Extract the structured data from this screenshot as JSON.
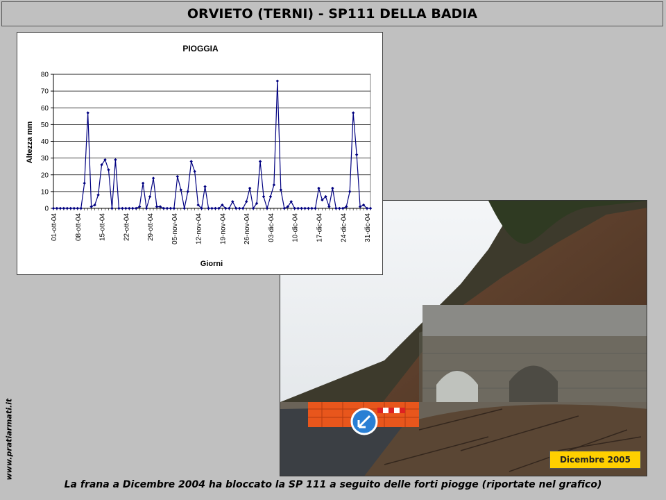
{
  "header": {
    "title": "ORVIETO (TERNI) - SP111 DELLA BADIA"
  },
  "side_url": "www.pratiarmati.it",
  "photo": {
    "date_label": "Dicembre 2005",
    "accent_color": "#ffd000"
  },
  "caption": "La frana a Dicembre 2004 ha bloccato la SP 111 a seguito delle forti piogge (riportate nel grafico)",
  "chart_data": {
    "type": "line",
    "title": "PIOGGIA",
    "xlabel": "Giorni",
    "ylabel": "Altezza mm",
    "ylim": [
      0,
      80
    ],
    "yticks": [
      0,
      10,
      20,
      30,
      40,
      50,
      60,
      70,
      80
    ],
    "grid": true,
    "color": "#000080",
    "x_tick_labels": [
      "01-ott-04",
      "08-ott-04",
      "15-ott-04",
      "22-ott-04",
      "29-ott-04",
      "05-nov-04",
      "12-nov-04",
      "19-nov-04",
      "26-nov-04",
      "03-dic-04",
      "10-dic-04",
      "17-dic-04",
      "24-dic-04",
      "31-dic-04"
    ],
    "values": [
      0,
      0,
      0,
      0,
      0,
      0,
      0,
      0,
      0,
      15,
      57,
      1,
      2,
      8,
      26,
      29,
      23,
      0,
      29,
      0,
      0,
      0,
      0,
      0,
      0,
      1,
      15,
      0,
      7,
      18,
      1,
      1,
      0,
      0,
      0,
      0,
      19,
      11,
      0,
      10,
      28,
      22,
      2,
      0,
      13,
      0,
      0,
      0,
      0,
      2,
      0,
      0,
      4,
      0,
      0,
      0,
      4,
      12,
      0,
      3,
      28,
      7,
      0,
      7,
      14,
      76,
      11,
      0,
      1,
      4,
      0,
      0,
      0,
      0,
      0,
      0,
      0,
      12,
      5,
      7,
      1,
      12,
      0,
      0,
      0,
      1,
      10,
      57,
      32,
      1,
      2,
      0,
      0
    ]
  }
}
